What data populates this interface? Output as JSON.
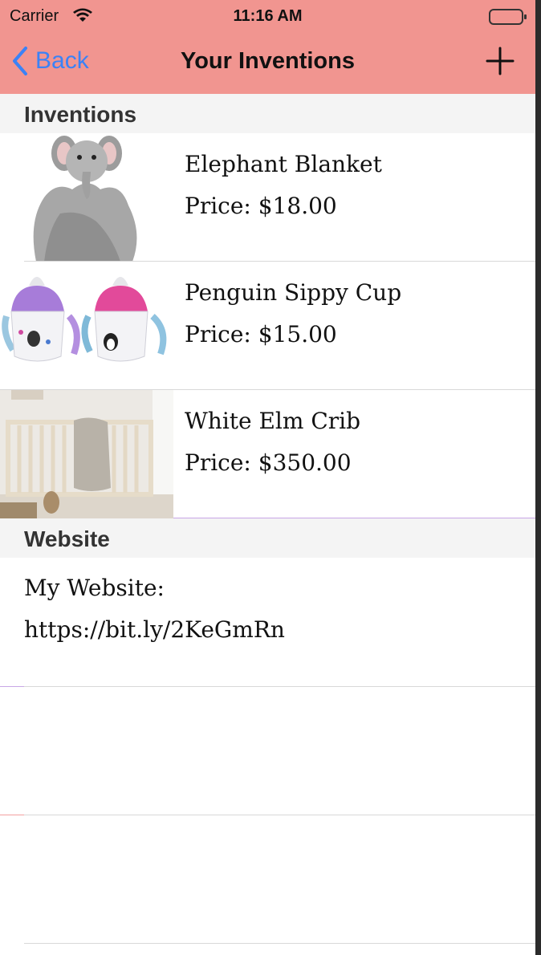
{
  "status_bar": {
    "carrier": "Carrier",
    "time": "11:16 AM"
  },
  "nav": {
    "back_label": "Back",
    "title": "Your Inventions",
    "add_icon": "plus-icon",
    "bar_color": "#f19590",
    "accent_color": "#3b82f6"
  },
  "sections": {
    "inventions_header": "Inventions",
    "website_header": "Website"
  },
  "inventions": [
    {
      "name": "Elephant Blanket",
      "price": "Price: $18.00",
      "image": "elephant-blanket-image"
    },
    {
      "name": "Penguin Sippy Cup",
      "price": "Price: $15.00",
      "image": "penguin-sippy-cup-image"
    },
    {
      "name": "White Elm Crib",
      "price": "Price: $350.00",
      "image": "white-elm-crib-image"
    }
  ],
  "website": {
    "label": "My Website:",
    "url": "https://bit.ly/2KeGmRn"
  }
}
